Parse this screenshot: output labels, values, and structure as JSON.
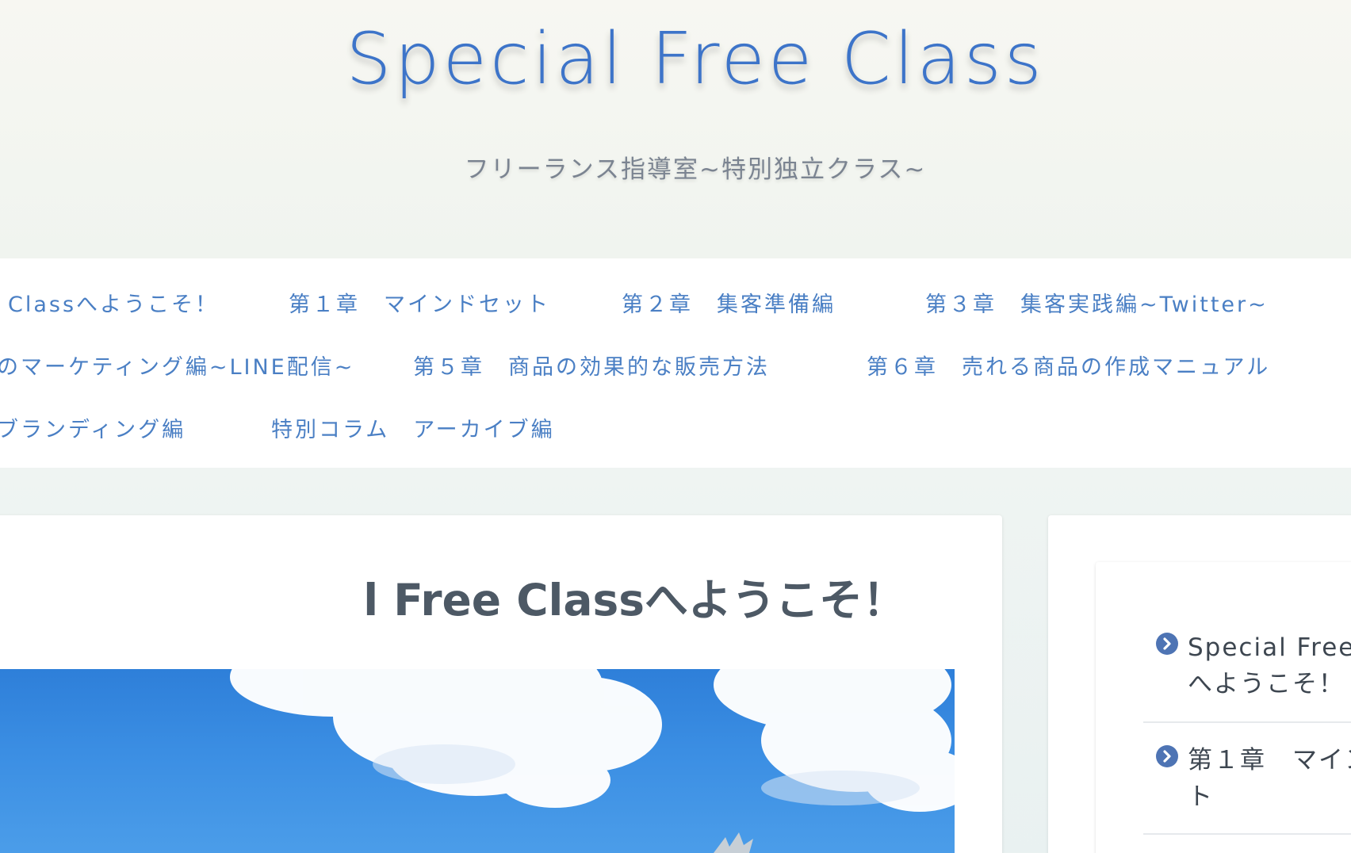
{
  "header": {
    "site_title": "Special Free Class",
    "site_subtitle": "フリーランス指導室~特別独立クラス~"
  },
  "nav": {
    "items": [
      {
        "label": "Classへようこそ！"
      },
      {
        "label": "第１章　マインドセット"
      },
      {
        "label": "第２章　集客準備編"
      },
      {
        "label": "第３章　集客実践編~Twitter~"
      },
      {
        "label": "のマーケティング編~LINE配信~"
      },
      {
        "label": "第５章　商品の効果的な販売方法"
      },
      {
        "label": "第６章　売れる商品の作成マニュアル"
      },
      {
        "label": "ブランディング編"
      },
      {
        "label": "特別コラム　アーカイブ編"
      }
    ]
  },
  "main": {
    "post_title": "l Free Classへようこそ！"
  },
  "sidebar": {
    "items": [
      {
        "label": "Special Free\nへようこそ！",
        "icon": "chevron-right-circle-icon"
      },
      {
        "label": "第１章　マイン\nト",
        "icon": "chevron-right-circle-icon"
      }
    ]
  },
  "colors": {
    "accent": "#3d74c9",
    "nav_link": "#4a7fc4",
    "sidebar_icon": "#4e74b4",
    "sky": "#3b8ee3"
  }
}
